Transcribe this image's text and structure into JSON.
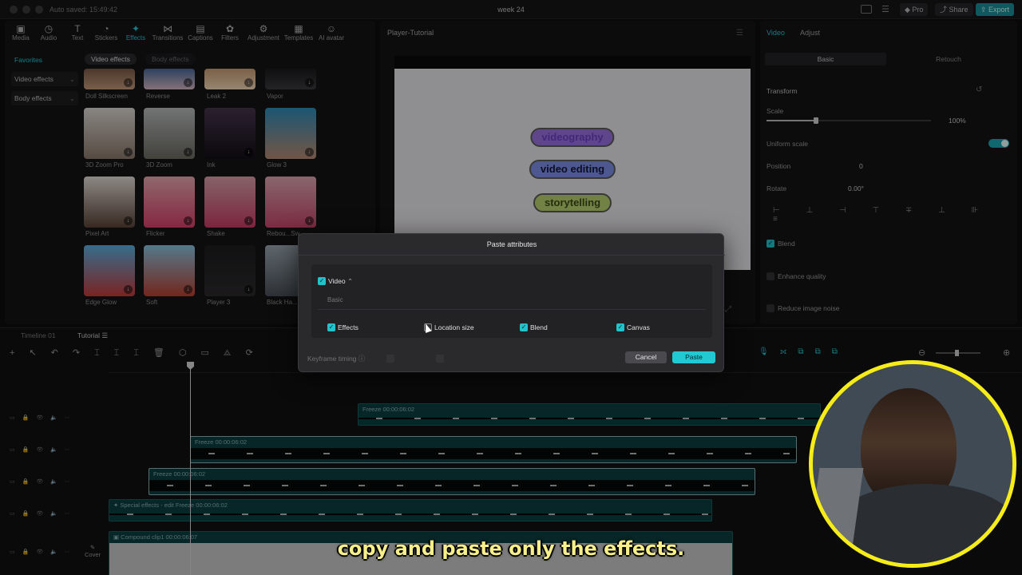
{
  "titlebar": {
    "autosave": "Auto saved: 15:49:42",
    "title": "week 24",
    "pro_label": "Pro",
    "share_label": "Share",
    "export_label": "Export"
  },
  "toolbar": {
    "tools": [
      {
        "label": "Media",
        "icon": "media-icon"
      },
      {
        "label": "Audio",
        "icon": "audio-icon"
      },
      {
        "label": "Text",
        "icon": "text-icon"
      },
      {
        "label": "Stickers",
        "icon": "stickers-icon"
      },
      {
        "label": "Effects",
        "icon": "effects-icon"
      },
      {
        "label": "Transitions",
        "icon": "transitions-icon"
      },
      {
        "label": "Captions",
        "icon": "captions-icon"
      },
      {
        "label": "Filters",
        "icon": "filters-icon"
      },
      {
        "label": "Adjustment",
        "icon": "adjustment-icon"
      },
      {
        "label": "Templates",
        "icon": "templates-icon"
      },
      {
        "label": "AI avatar",
        "icon": "ai-avatar-icon"
      }
    ]
  },
  "effects_panel": {
    "nav": [
      "Favorites",
      "Video effects",
      "Body effects"
    ],
    "tabs": [
      "Video effects",
      "Body effects"
    ],
    "rows": [
      [
        "Doll Silkscreen",
        "Reverse",
        "Leak 2",
        "Vapor"
      ],
      [
        "3D Zoom Pro",
        "3D Zoom",
        "Ink",
        "Glow 3"
      ],
      [
        "Pixel Art",
        "Flicker",
        "Shake",
        "Rebou...Sw"
      ],
      [
        "Edge Glow",
        "Soft",
        "Player 3",
        "Black Ha..."
      ]
    ]
  },
  "player": {
    "title": "Player-Tutorial",
    "tags": [
      "videography",
      "video editing",
      "storytelling"
    ],
    "colors": {
      "videography": "#9a72e0",
      "video editing": "#7c8fe6",
      "storytelling": "#b8d26e"
    }
  },
  "properties": {
    "tabs": [
      "Video",
      "Adjust"
    ],
    "subtabs": [
      "Basic",
      "Retouch"
    ],
    "transform_label": "Transform",
    "scale_label": "Scale",
    "scale_value": "100%",
    "scale_fraction": 0.3,
    "uniform_label": "Uniform scale",
    "position_label": "Position",
    "position_x": "0",
    "rotate_label": "Rotate",
    "rotate_value": "0.00°",
    "blend_label": "Blend",
    "enhance_label": "Enhance quality",
    "noise_label": "Reduce image noise"
  },
  "timeline": {
    "title": "Timeline 01",
    "tab": "Tutorial",
    "clips": [
      {
        "label": "Freeze",
        "time": "00:00:06:02"
      },
      {
        "label": "Freeze",
        "time": "00:00:06:02"
      },
      {
        "label": "Freeze",
        "time": "00:00:06:02"
      },
      {
        "label": "Special effects - edit",
        "time": "Freeze  00:00:06:02"
      },
      {
        "label": "Compound clip1",
        "time": "00:00:06:07"
      }
    ],
    "cover_label": "Cover"
  },
  "dialog": {
    "title": "Paste attributes",
    "section": "Video",
    "subsection": "Basic",
    "options": [
      {
        "label": "Effects",
        "checked": true
      },
      {
        "label": "Location size",
        "checked": false
      },
      {
        "label": "Blend",
        "checked": true
      },
      {
        "label": "Canvas",
        "checked": true
      }
    ],
    "keyframe_label": "Keyframe timing",
    "cancel_label": "Cancel",
    "paste_label": "Paste"
  },
  "subtitle": "copy and paste only the effects."
}
